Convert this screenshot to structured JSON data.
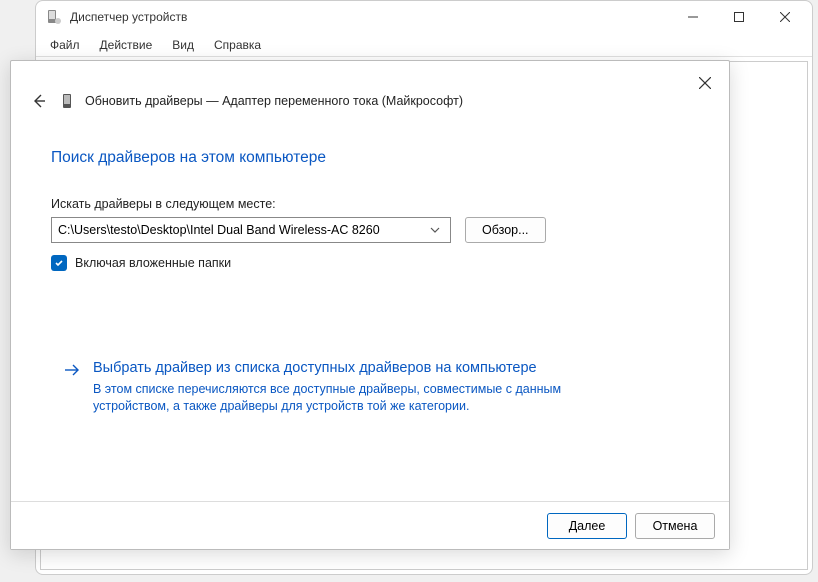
{
  "window": {
    "title": "Диспетчер устройств"
  },
  "menubar": {
    "file": "Файл",
    "action": "Действие",
    "view": "Вид",
    "help": "Справка"
  },
  "dialog": {
    "header": "Обновить драйверы — Адаптер переменного тока (Майкрософт)",
    "section_title": "Поиск драйверов на этом компьютере",
    "search_label": "Искать драйверы в следующем месте:",
    "path_value": "C:\\Users\\testo\\Desktop\\Intel Dual Band Wireless-AC 8260",
    "browse_label": "Обзор...",
    "subfolders_label": "Включая вложенные папки",
    "option_title": "Выбрать драйвер из списка доступных драйверов на компьютере",
    "option_desc": "В этом списке перечисляются все доступные драйверы, совместимые с данным устройством, а также драйверы для устройств той же категории.",
    "next_label": "Далее",
    "cancel_label": "Отмена"
  }
}
